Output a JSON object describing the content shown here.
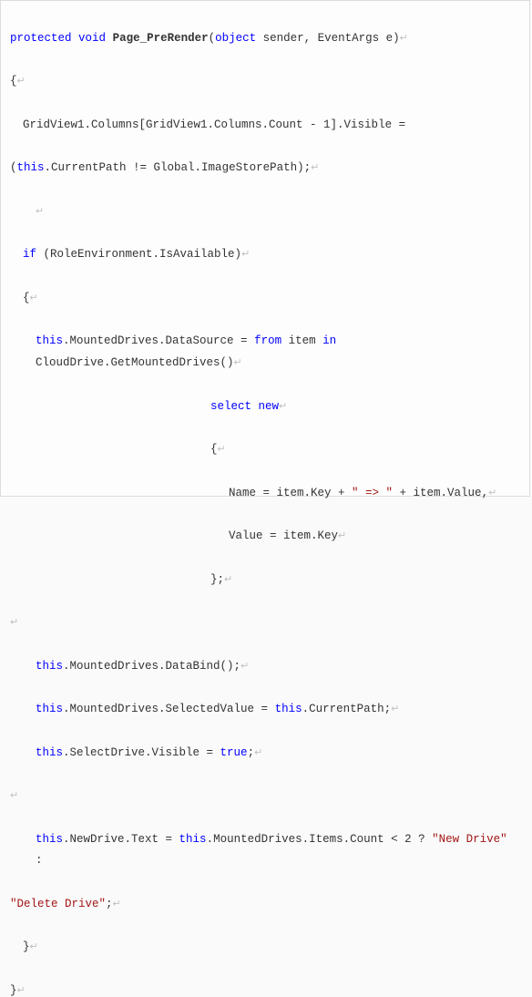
{
  "tokens": {
    "kw_protected": "protected",
    "kw_void": "void",
    "kw_object": "object",
    "kw_this": "this",
    "kw_if": "if",
    "kw_from": "from",
    "kw_in": "in",
    "kw_select": "select",
    "kw_new": "new",
    "kw_true": "true",
    "method_name": "Page_PreRender",
    "sender": " sender, EventArgs e)",
    "lparen": "(",
    "pilcrow": "↵",
    "brace_open": "{",
    "brace_close": "}",
    "l2_a": "GridView1.Columns[GridView1.Columns.Count - 1].Visible = ",
    "l2_b": "(",
    "l2_c": ".CurrentPath != Global.ImageStorePath);",
    "l3": " (RoleEnvironment.IsAvailable)",
    "l4_a": ".MountedDrives.DataSource = ",
    "l4_b": " item ",
    "l4_c": " CloudDrive.GetMountedDrives()",
    "l5_a": "Name = item.Key + ",
    "l5_str1": "\" => \"",
    "l5_b": " + item.Value,",
    "l6": "Value = item.Key",
    "l7": "};",
    "l8_a": ".MountedDrives.DataBind();",
    "l9_a": ".MountedDrives.SelectedValue = ",
    "l9_b": ".CurrentPath;",
    "l10_a": ".SelectDrive.Visible = ",
    "l10_b": ";",
    "l11_a": ".NewDrive.Text = ",
    "l11_b": ".MountedDrives.Items.Count < 2 ? ",
    "l11_str1": "\"New Drive\"",
    "l11_c": " : ",
    "l11_str2": "\"Delete Drive\"",
    "l11_d": ";",
    "sp": " "
  }
}
